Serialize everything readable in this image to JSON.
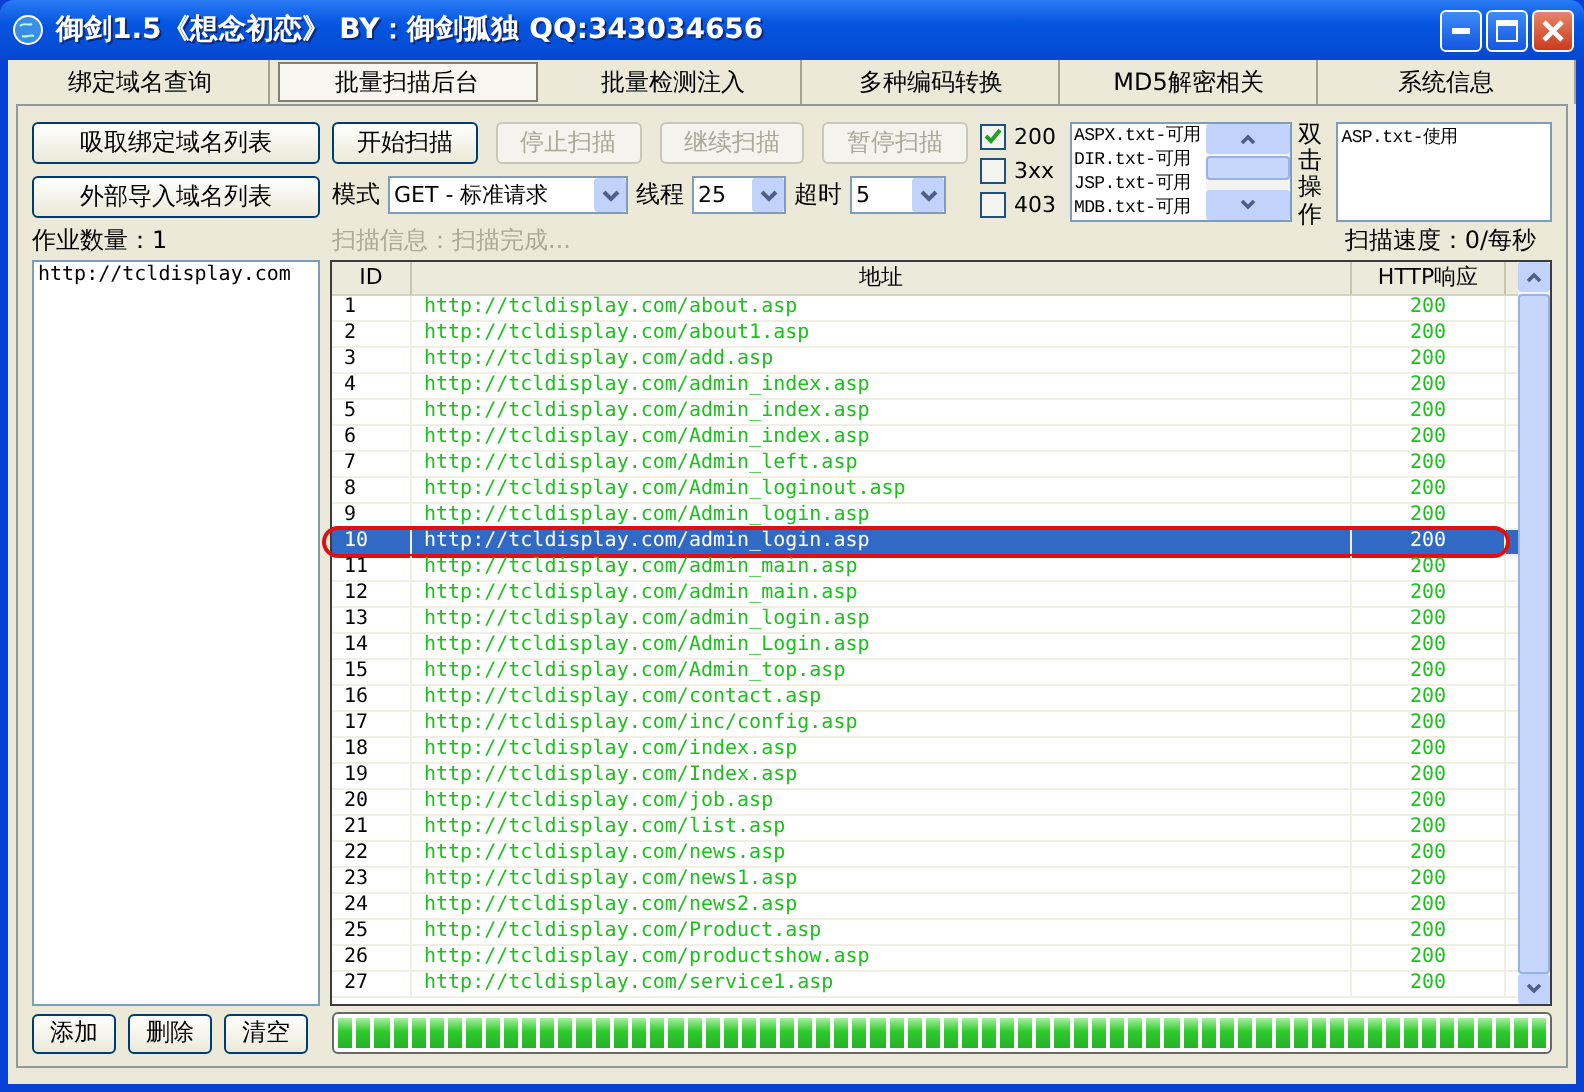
{
  "window": {
    "title": "御剑1.5《想念初恋》 BY：御剑孤独 QQ:343034656"
  },
  "tabs": [
    {
      "label": "绑定域名查询",
      "selected": false
    },
    {
      "label": "批量扫描后台",
      "selected": true
    },
    {
      "label": "批量检测注入",
      "selected": false
    },
    {
      "label": "多种编码转换",
      "selected": false
    },
    {
      "label": "MD5解密相关",
      "selected": false
    },
    {
      "label": "系统信息",
      "selected": false
    }
  ],
  "left_buttons": [
    "吸取绑定域名列表",
    "外部导入域名列表"
  ],
  "scan_buttons": [
    {
      "label": "开始扫描",
      "disabled": false
    },
    {
      "label": "停止扫描",
      "disabled": true
    },
    {
      "label": "继续扫描",
      "disabled": true
    },
    {
      "label": "暂停扫描",
      "disabled": true
    }
  ],
  "mode": {
    "label": "模式",
    "value": "GET - 标准请求"
  },
  "threads": {
    "label": "线程",
    "value": "25"
  },
  "timeout": {
    "label": "超时",
    "value": "5"
  },
  "status_filters": [
    {
      "label": "200",
      "checked": true
    },
    {
      "label": "3xx",
      "checked": false
    },
    {
      "label": "403",
      "checked": false
    }
  ],
  "dictionaries": [
    "ASPX.txt-可用",
    "DIR.txt-可用",
    "JSP.txt-可用",
    "MDB.txt-可用"
  ],
  "dictionary_hint": "双击操作",
  "selected_dictionaries": [
    "ASP.txt-使用"
  ],
  "job_count": "作业数量：1",
  "domains": [
    "http://tcldisplay.com"
  ],
  "scan_info": "扫描信息：扫描完成...",
  "scan_speed": "扫描速度：0/每秒",
  "table": {
    "columns": [
      "ID",
      "地址",
      "HTTP响应"
    ],
    "rows": [
      {
        "id": "1",
        "url": "http://tcldisplay.com/about.asp",
        "status": "200",
        "selected": false,
        "circled": false
      },
      {
        "id": "2",
        "url": "http://tcldisplay.com/about1.asp",
        "status": "200",
        "selected": false,
        "circled": false
      },
      {
        "id": "3",
        "url": "http://tcldisplay.com/add.asp",
        "status": "200",
        "selected": false,
        "circled": false
      },
      {
        "id": "4",
        "url": "http://tcldisplay.com/admin_index.asp",
        "status": "200",
        "selected": false,
        "circled": false
      },
      {
        "id": "5",
        "url": "http://tcldisplay.com/admin_index.asp",
        "status": "200",
        "selected": false,
        "circled": false
      },
      {
        "id": "6",
        "url": "http://tcldisplay.com/Admin_index.asp",
        "status": "200",
        "selected": false,
        "circled": false
      },
      {
        "id": "7",
        "url": "http://tcldisplay.com/Admin_left.asp",
        "status": "200",
        "selected": false,
        "circled": false
      },
      {
        "id": "8",
        "url": "http://tcldisplay.com/Admin_loginout.asp",
        "status": "200",
        "selected": false,
        "circled": false
      },
      {
        "id": "9",
        "url": "http://tcldisplay.com/Admin_login.asp",
        "status": "200",
        "selected": false,
        "circled": false
      },
      {
        "id": "10",
        "url": "http://tcldisplay.com/admin_login.asp",
        "status": "200",
        "selected": true,
        "circled": true
      },
      {
        "id": "11",
        "url": "http://tcldisplay.com/admin_main.asp",
        "status": "200",
        "selected": false,
        "circled": false
      },
      {
        "id": "12",
        "url": "http://tcldisplay.com/admin_main.asp",
        "status": "200",
        "selected": false,
        "circled": false
      },
      {
        "id": "13",
        "url": "http://tcldisplay.com/admin_login.asp",
        "status": "200",
        "selected": false,
        "circled": false
      },
      {
        "id": "14",
        "url": "http://tcldisplay.com/Admin_Login.asp",
        "status": "200",
        "selected": false,
        "circled": false
      },
      {
        "id": "15",
        "url": "http://tcldisplay.com/Admin_top.asp",
        "status": "200",
        "selected": false,
        "circled": false
      },
      {
        "id": "16",
        "url": "http://tcldisplay.com/contact.asp",
        "status": "200",
        "selected": false,
        "circled": false
      },
      {
        "id": "17",
        "url": "http://tcldisplay.com/inc/config.asp",
        "status": "200",
        "selected": false,
        "circled": false
      },
      {
        "id": "18",
        "url": "http://tcldisplay.com/index.asp",
        "status": "200",
        "selected": false,
        "circled": false
      },
      {
        "id": "19",
        "url": "http://tcldisplay.com/Index.asp",
        "status": "200",
        "selected": false,
        "circled": false
      },
      {
        "id": "20",
        "url": "http://tcldisplay.com/job.asp",
        "status": "200",
        "selected": false,
        "circled": false
      },
      {
        "id": "21",
        "url": "http://tcldisplay.com/list.asp",
        "status": "200",
        "selected": false,
        "circled": false
      },
      {
        "id": "22",
        "url": "http://tcldisplay.com/news.asp",
        "status": "200",
        "selected": false,
        "circled": false
      },
      {
        "id": "23",
        "url": "http://tcldisplay.com/news1.asp",
        "status": "200",
        "selected": false,
        "circled": false
      },
      {
        "id": "24",
        "url": "http://tcldisplay.com/news2.asp",
        "status": "200",
        "selected": false,
        "circled": false
      },
      {
        "id": "25",
        "url": "http://tcldisplay.com/Product.asp",
        "status": "200",
        "selected": false,
        "circled": false
      },
      {
        "id": "26",
        "url": "http://tcldisplay.com/productshow.asp",
        "status": "200",
        "selected": false,
        "circled": false
      },
      {
        "id": "27",
        "url": "http://tcldisplay.com/service1.asp",
        "status": "200",
        "selected": false,
        "circled": false
      }
    ]
  },
  "list_buttons": [
    "添加",
    "删除",
    "清空"
  ],
  "progress": {
    "level": 1
  }
}
